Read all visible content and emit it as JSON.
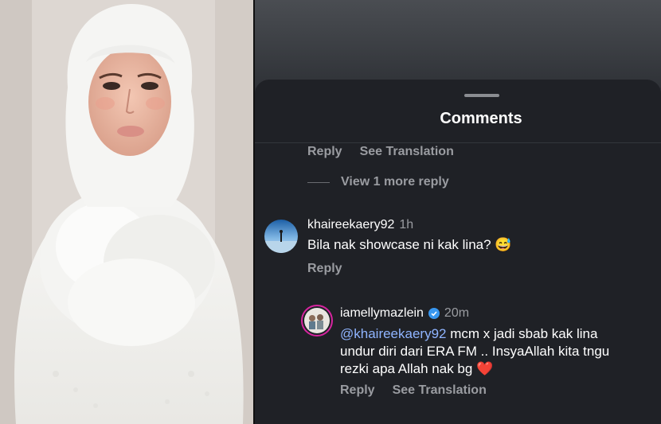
{
  "sheet": {
    "title": "Comments"
  },
  "top_actions": {
    "reply": "Reply",
    "see_translation": "See Translation"
  },
  "view_more": "View 1 more reply",
  "comments": [
    {
      "username": "khaireekaery92",
      "time": "1h",
      "text": "Bila nak showcase ni kak lina?",
      "emoji": "😅",
      "reply_label": "Reply"
    },
    {
      "username": "iamellymazlein",
      "time": "20m",
      "verified": true,
      "mention": "@khaireekaery92",
      "text_line1": " mcm x jadi sbab kak lina",
      "text_line2": "undur diri dari ERA FM .. InsyaAllah kita tngu",
      "text_line3": "rezki apa Allah nak bg",
      "emoji": "❤️",
      "reply_label": "Reply",
      "translation_label": "See Translation"
    }
  ],
  "colors": {
    "sheet_bg": "#1f2126",
    "mention": "#8fb4ff",
    "verified": "#3897f0",
    "secondary_text": "#9a9ca1"
  }
}
